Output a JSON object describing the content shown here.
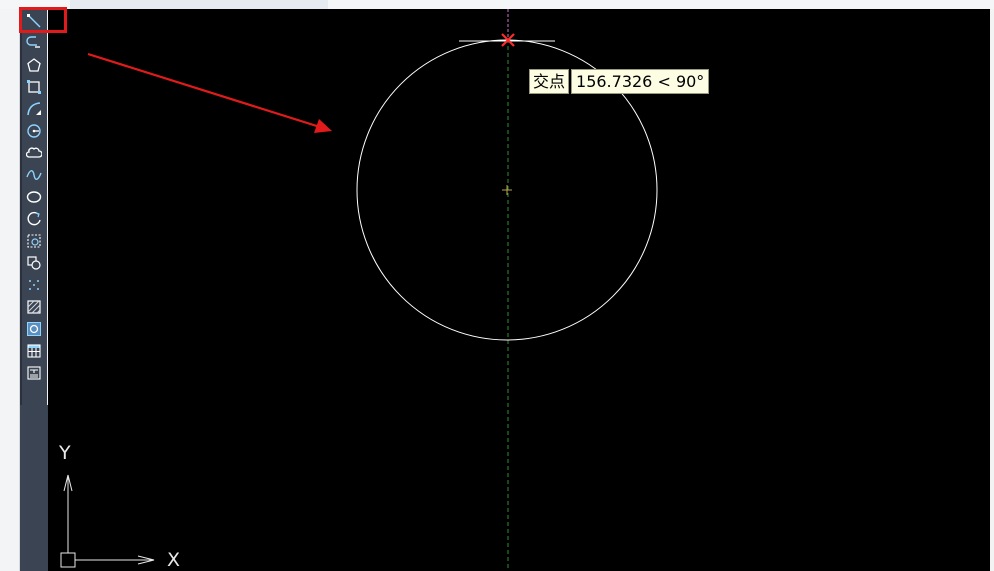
{
  "toolbar": {
    "tools": [
      {
        "icon": "line-icon"
      },
      {
        "icon": "polyline-icon"
      },
      {
        "icon": "polygon-icon"
      },
      {
        "icon": "rectangle-icon"
      },
      {
        "icon": "arc-icon"
      },
      {
        "icon": "circle-icon"
      },
      {
        "icon": "revision-cloud-icon"
      },
      {
        "icon": "spline-icon"
      },
      {
        "icon": "ellipse-icon"
      },
      {
        "icon": "ellipse-arc-icon"
      },
      {
        "icon": "insert-block-icon"
      },
      {
        "icon": "make-block-icon"
      },
      {
        "icon": "point-icon"
      },
      {
        "icon": "hatch-icon"
      },
      {
        "icon": "region-icon"
      },
      {
        "icon": "table-icon"
      },
      {
        "icon": "multiline-text-icon"
      }
    ],
    "highlight_color": "#e11b1b"
  },
  "tooltip": {
    "label": "交点",
    "value": "156.7326 < 90°"
  },
  "ucs": {
    "x_label": "X",
    "y_label": "Y"
  },
  "colors": {
    "canvas": "#000000",
    "circle": "#ffffff",
    "center_line": "#2f8f2f",
    "snap_marker": "#ff2a2a",
    "tracking_line": "#d070d0",
    "arrow": "#e11b1b"
  }
}
